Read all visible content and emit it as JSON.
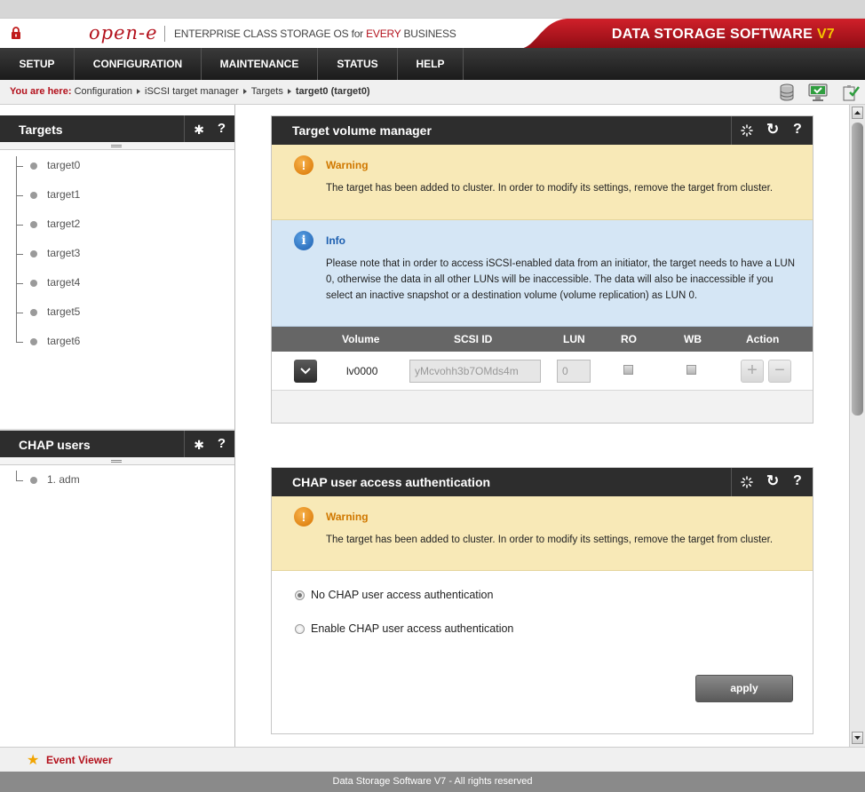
{
  "header": {
    "logo": "open-e",
    "tagline_pre": "ENTERPRISE CLASS STORAGE OS for ",
    "tagline_highlight": "EVERY",
    "tagline_post": " BUSINESS",
    "brand": "DATA STORAGE SOFTWARE ",
    "brand_version": "V7"
  },
  "menu": [
    "SETUP",
    "CONFIGURATION",
    "MAINTENANCE",
    "STATUS",
    "HELP"
  ],
  "breadcrumb": {
    "lead": "You are here:",
    "items": [
      "Configuration",
      "iSCSI target manager",
      "Targets"
    ],
    "current": "target0 (target0)"
  },
  "targets_panel": {
    "title": "Targets",
    "gear_glyph": "✱",
    "help_glyph": "?",
    "items": [
      "target0",
      "target1",
      "target2",
      "target3",
      "target4",
      "target5",
      "target6"
    ]
  },
  "chap_users_panel": {
    "title": "CHAP users",
    "gear_glyph": "✱",
    "help_glyph": "?",
    "items": [
      "1. adm"
    ]
  },
  "volume_manager": {
    "title": "Target volume manager",
    "refresh_glyph": "↻",
    "help_glyph": "?",
    "warning": {
      "icon_glyph": "!",
      "title": "Warning",
      "text": "The target has been added to cluster. In order to modify its settings, remove the target from cluster."
    },
    "info": {
      "icon_glyph": "i",
      "title": "Info",
      "text": "Please note that in order to access iSCSI-enabled data from an initiator, the target needs to have a LUN 0, otherwise the data in all other LUNs will be inaccessible. The data will also be inaccessible if you select an inactive snapshot or a destination volume (volume replication) as LUN 0."
    },
    "columns": [
      "Volume",
      "SCSI ID",
      "LUN",
      "RO",
      "WB",
      "Action"
    ],
    "rows": [
      {
        "volume": "lv0000",
        "scsi_id": "yMcvohh3b7OMds4m",
        "lun": "0",
        "ro": false,
        "wb": false,
        "add_glyph": "+",
        "remove_glyph": "−"
      }
    ]
  },
  "chap_auth": {
    "title": "CHAP user access authentication",
    "refresh_glyph": "↻",
    "help_glyph": "?",
    "warning": {
      "icon_glyph": "!",
      "title": "Warning",
      "text": "The target has been added to cluster. In order to modify its settings, remove the target from cluster."
    },
    "options": [
      "No CHAP user access authentication",
      "Enable CHAP user access authentication"
    ],
    "selected_option": 0,
    "apply_label": "apply"
  },
  "footer": {
    "event_viewer": "Event Viewer",
    "star_glyph": "★",
    "copyright": "Data Storage Software V7 - All rights reserved"
  },
  "colors": {
    "brand_red": "#b3111c",
    "menu_dark": "#2d2d2d",
    "warning_bg": "#f8e9b7",
    "info_bg": "#d5e6f5",
    "version_yellow": "#f5c400"
  }
}
